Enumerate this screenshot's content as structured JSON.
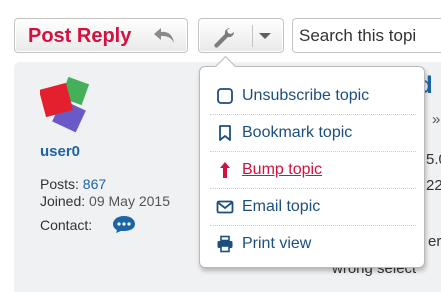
{
  "toolbar": {
    "post_reply_label": "Post Reply",
    "search_placeholder": "Search this topi"
  },
  "post": {
    "author": {
      "username": "user0",
      "posts_label": "Posts:",
      "posts_value": "867",
      "joined_label": "Joined:",
      "joined_value": "09 May 2015",
      "contact_label": "Contact:"
    },
    "title_fragment": "d",
    "fragments": {
      "breadcrumb_arrow": "»",
      "version_fragment": "5.0",
      "number_fragment": "22",
      "text_fragment_1": "er",
      "text_fragment_2": "wrong select"
    }
  },
  "topic_tools_menu": {
    "items": [
      {
        "label": "Unsubscribe topic",
        "icon": "checkbox-square-icon"
      },
      {
        "label": "Bookmark topic",
        "icon": "bookmark-icon"
      },
      {
        "label": "Bump topic",
        "icon": "arrow-up-icon",
        "active": true
      },
      {
        "label": "Email topic",
        "icon": "envelope-icon"
      },
      {
        "label": "Print view",
        "icon": "printer-icon"
      }
    ]
  },
  "colors": {
    "brand_red": "#d31141",
    "link_blue": "#1d64a6",
    "menu_text": "#1d4f7e",
    "post_background": "#f0f1f3"
  }
}
